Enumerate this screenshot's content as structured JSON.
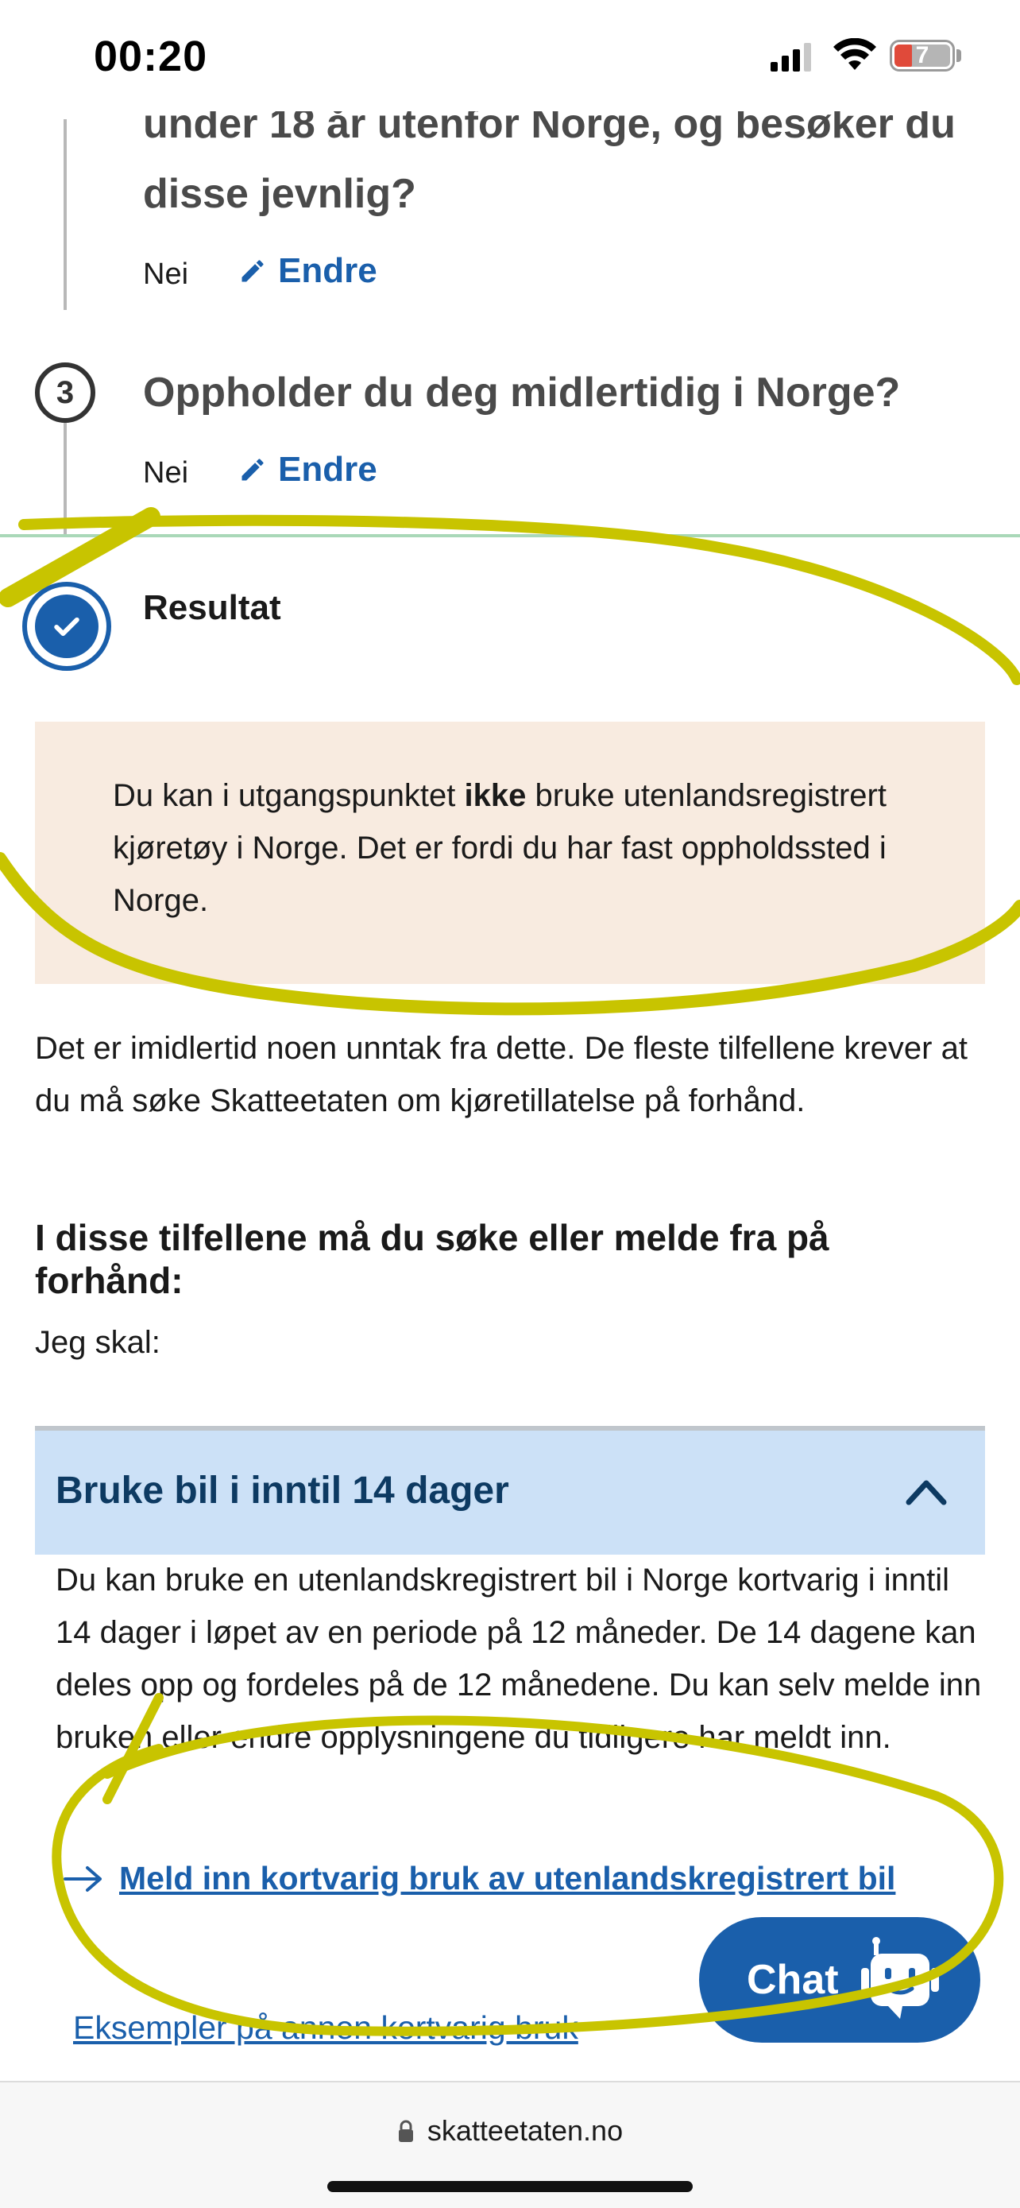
{
  "status_bar": {
    "time": "00:20",
    "battery": "7"
  },
  "steps": {
    "q2_text": "under 18 år utenfor Norge, og besøker du disse jevnlig?",
    "q2_answer": "Nei",
    "q3_number": "3",
    "q3_text": "Oppholder du deg midlertidig i Norge?",
    "q3_answer": "Nei",
    "edit_label": "Endre",
    "result_label": "Resultat"
  },
  "result_box": {
    "before": "Du kan i utgangspunktet ",
    "bold": "ikke",
    "after": " bruke utenlandsregistrert kjøretøy i Norge. Det er fordi du har fast oppholdssted i Norge."
  },
  "main": {
    "intro": "Det er imidlertid noen unntak fra dette. De fleste tilfellene krever at du må søke Skatteetaten om kjøretillatelse på forhånd.",
    "heading": "I disse tilfellene må du søke eller melde fra på forhånd:",
    "sub": "Jeg skal:"
  },
  "accordion": {
    "title": "Bruke bil i inntil 14 dager",
    "body": "Du kan bruke en utenlandskregistrert bil i Norge kortvarig i inntil 14 dager i løpet av en periode på 12 måneder. De 14 dagene kan deles opp og fordeles på de 12 månedene. Du kan selv melde inn bruken eller endre opplysningene du tidligere har meldt inn.",
    "link": "Meld inn kortvarig bruk av utenlandskregistrert bil"
  },
  "secondary_link": "Eksempler på annen kortvarig bruk",
  "chat": {
    "label": "Chat"
  },
  "browser": {
    "url": "skatteetaten.no"
  },
  "colors": {
    "link": "#1a5fab",
    "accordion_bg": "#cce1f7",
    "info_bg": "#f8ebe0",
    "highlighter": "#c8c400"
  },
  "icons": [
    "pencil-icon",
    "check-icon",
    "chevron-up-icon",
    "arrow-right-icon",
    "chat-bot-icon",
    "lock-icon",
    "signal-icon",
    "wifi-icon",
    "battery-icon"
  ]
}
